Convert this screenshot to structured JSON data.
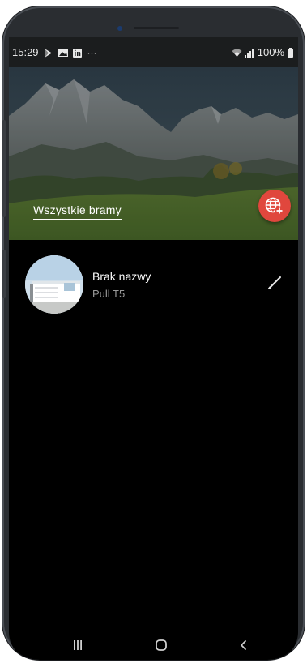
{
  "status_bar": {
    "time": "15:29",
    "more": "···",
    "battery": "100%",
    "icons": [
      "play-store-icon",
      "gallery-icon",
      "linkedin-icon",
      "wifi-icon",
      "signal-icon",
      "battery-icon"
    ]
  },
  "header": {
    "title": "Wszystkie bramy",
    "add_button_icon": "globe-add-icon",
    "accent": "#e0473d"
  },
  "gates": [
    {
      "name": "Brak nazwy",
      "model": "Pull T5",
      "edit_icon": "pencil-icon"
    }
  ],
  "nav": {
    "recents_icon": "recents-icon",
    "home_icon": "home-icon",
    "back_icon": "back-icon"
  }
}
